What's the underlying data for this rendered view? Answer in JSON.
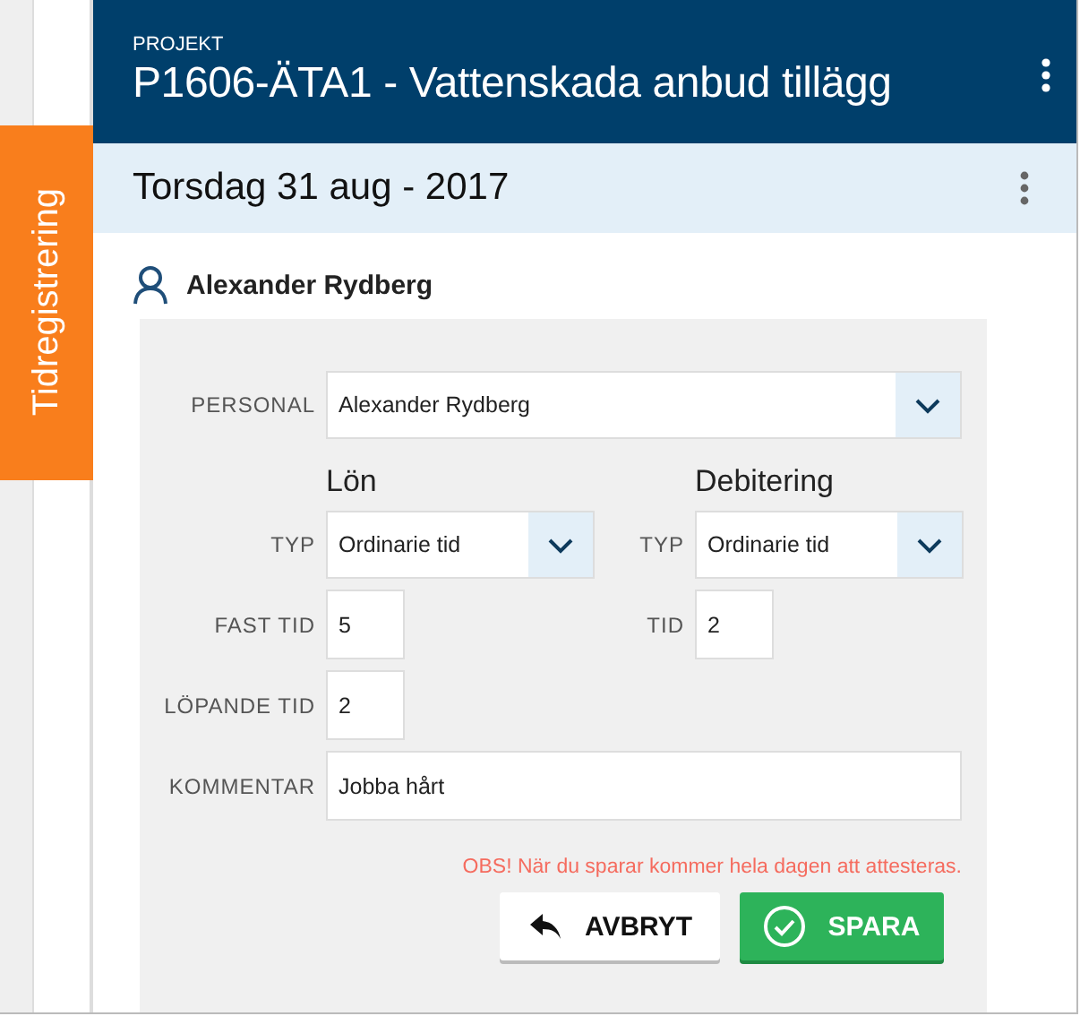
{
  "side_tab": {
    "label": "Tidregistrering"
  },
  "header": {
    "overline": "PROJEKT",
    "title": "P1606-ÄTA1 - Vattenskada anbud tillägg"
  },
  "date_bar": {
    "title": "Torsdag 31 aug - 2017"
  },
  "person": {
    "name": "Alexander Rydberg"
  },
  "form": {
    "personal": {
      "label": "PERSONAL",
      "value": "Alexander Rydberg"
    },
    "sections": [
      {
        "heading": "Lön",
        "fields": [
          {
            "kind": "select",
            "label": "TYP",
            "value": "Ordinarie tid"
          },
          {
            "kind": "number",
            "label": "FAST TID",
            "value": "5"
          },
          {
            "kind": "number",
            "label": "LÖPANDE TID",
            "value": "2"
          }
        ]
      },
      {
        "heading": "Debitering",
        "fields": [
          {
            "kind": "select",
            "label": "TYP",
            "value": "Ordinarie tid"
          },
          {
            "kind": "number",
            "label": "TID",
            "value": "2"
          }
        ]
      }
    ],
    "comment": {
      "label": "KOMMENTAR",
      "value": "Jobba hårt"
    },
    "warning": "OBS! När du sparar kommer hela dagen att attesteras.",
    "buttons": [
      {
        "kind": "cancel",
        "label": "AVBRYT"
      },
      {
        "kind": "save",
        "label": "SPARA"
      }
    ]
  }
}
